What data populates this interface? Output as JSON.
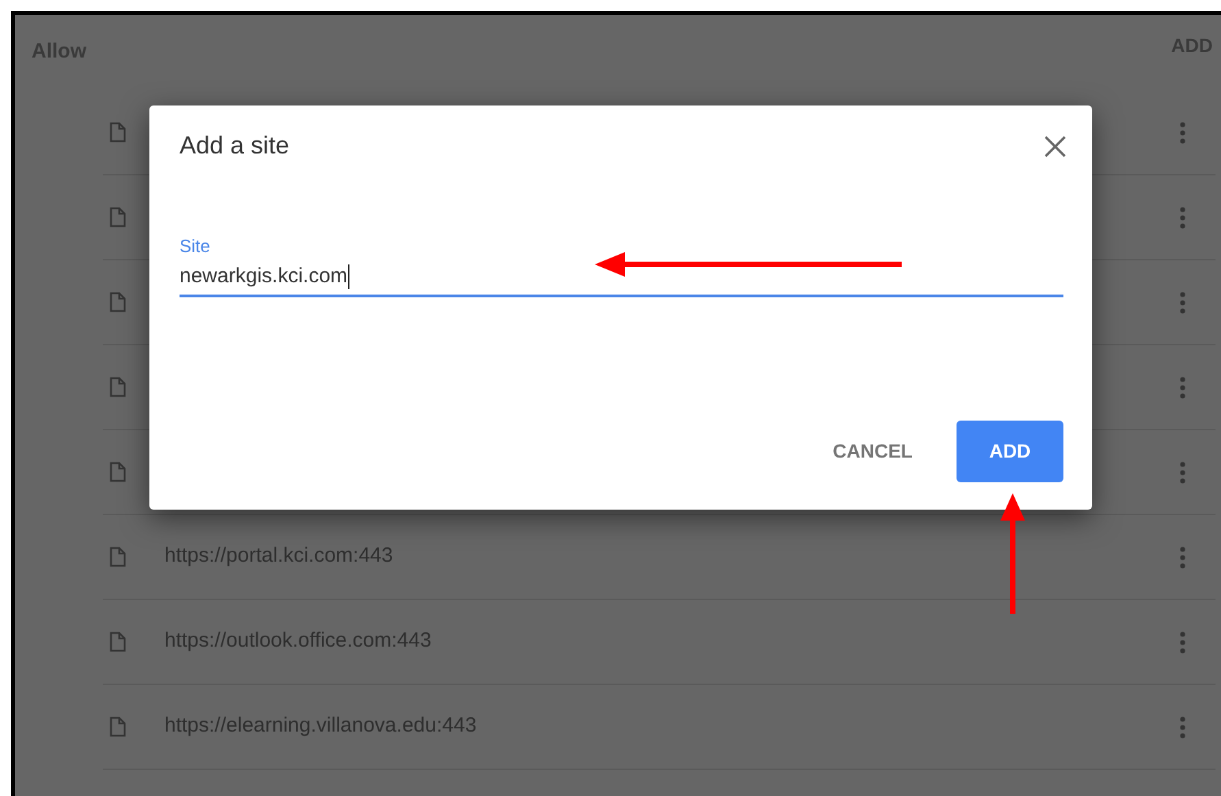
{
  "header": {
    "title": "Allow",
    "add_label": "ADD"
  },
  "rows": [
    {
      "kind": "covered"
    },
    {
      "kind": "covered"
    },
    {
      "kind": "covered"
    },
    {
      "kind": "covered"
    },
    {
      "kind": "covered"
    },
    {
      "kind": "site",
      "url": "https://portal.kci.com:443"
    },
    {
      "kind": "site",
      "url": "https://outlook.office.com:443"
    },
    {
      "kind": "site",
      "url": "https://elearning.villanova.edu:443"
    }
  ],
  "dialog": {
    "title": "Add a site",
    "field_label": "Site",
    "field_value": "newarkgis.kci.com",
    "buttons": [
      {
        "kind": "text",
        "label": "CANCEL"
      },
      {
        "kind": "primary",
        "label": "ADD"
      }
    ]
  }
}
